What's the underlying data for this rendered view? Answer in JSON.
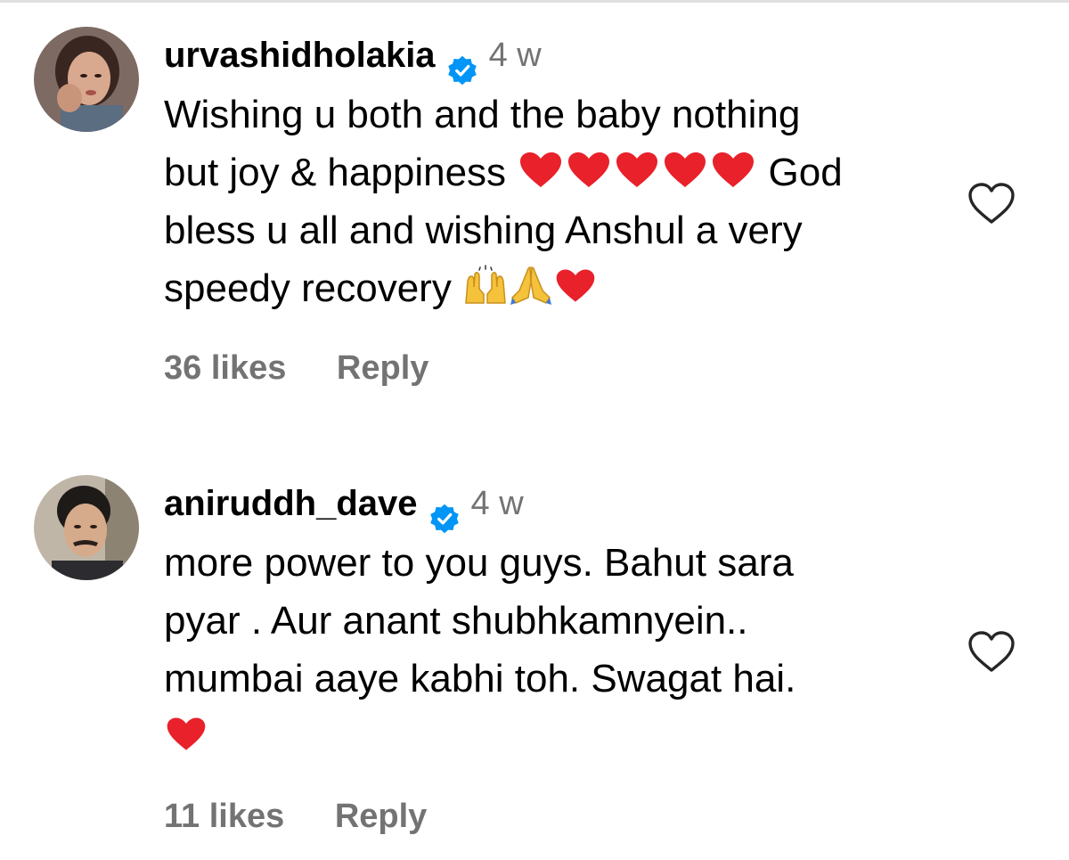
{
  "comments": [
    {
      "username": "urvashidholakia",
      "time": "4 w",
      "text": {
        "line1": "Wishing u both and the baby nothing",
        "line2_prefix": "but joy & happiness",
        "line2_suffix": "God",
        "line3": "bless u all and wishing Anshul a very",
        "line4_prefix": "speedy recovery"
      },
      "likes": "36 likes",
      "reply": "Reply"
    },
    {
      "username": "aniruddh_dave",
      "time": "4 w",
      "text": {
        "line1": "more power to you guys. Bahut sara",
        "line2": "pyar . Aur anant shubhkamnyein..",
        "line3": "mumbai aaye kabhi toh. Swagat hai."
      },
      "likes": "11 likes",
      "reply": "Reply"
    }
  ],
  "colors": {
    "verified": "#0095f6",
    "muted": "#737373",
    "heart_emoji": "#e8212b"
  },
  "icons": [
    "verified-badge-icon",
    "heart-outline-icon",
    "red-heart-emoji",
    "raising-hands-emoji",
    "folded-hands-emoji"
  ]
}
